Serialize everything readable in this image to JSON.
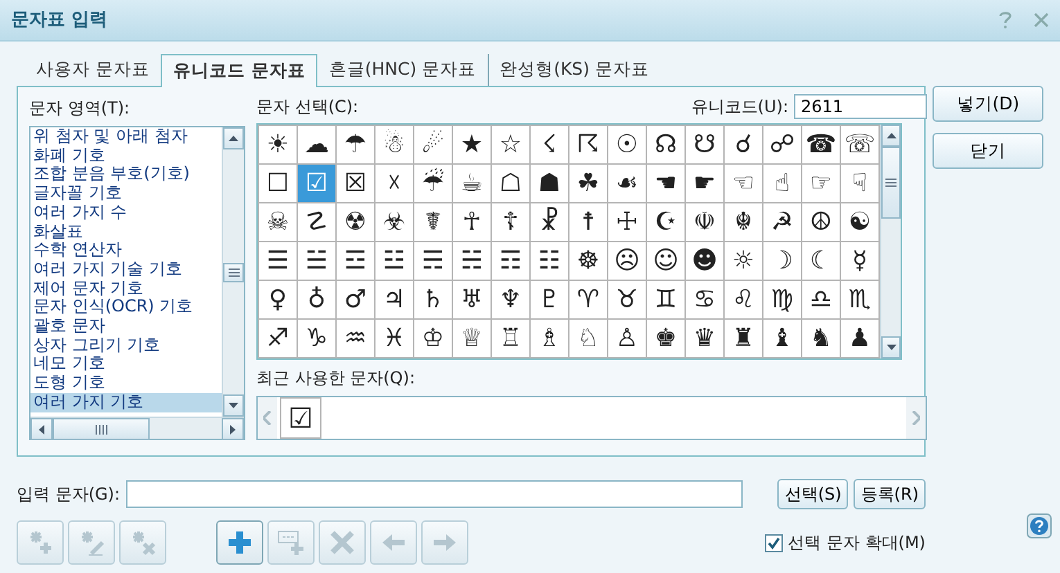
{
  "window": {
    "title": "문자표 입력"
  },
  "tabs": [
    {
      "label": "사용자 문자표",
      "selected": false
    },
    {
      "label": "유니코드 문자표",
      "selected": true
    },
    {
      "label": "흔글(HNC) 문자표",
      "selected": false
    },
    {
      "label": "완성형(KS) 문자표",
      "selected": false
    }
  ],
  "category": {
    "label": "문자 영역(T):",
    "items": [
      {
        "label": "위 첨자 및 아래 첨자",
        "selected": false
      },
      {
        "label": "화폐 기호",
        "selected": false
      },
      {
        "label": "조합 분음 부호(기호)",
        "selected": false
      },
      {
        "label": "글자꼴 기호",
        "selected": false
      },
      {
        "label": "여러 가지 수",
        "selected": false
      },
      {
        "label": "화살표",
        "selected": false
      },
      {
        "label": "수학 연산자",
        "selected": false
      },
      {
        "label": "여러 가지 기술 기호",
        "selected": false
      },
      {
        "label": "제어 문자 기호",
        "selected": false
      },
      {
        "label": "문자 인식(OCR) 기호",
        "selected": false
      },
      {
        "label": "괄호 문자",
        "selected": false
      },
      {
        "label": "상자 그리기 기호",
        "selected": false
      },
      {
        "label": "네모 기호",
        "selected": false
      },
      {
        "label": "도형 기호",
        "selected": false
      },
      {
        "label": "여러 가지 기호",
        "selected": true
      }
    ]
  },
  "chars": {
    "label": "문자 선택(C):",
    "code_label": "유니코드(U):",
    "code_value": "2611",
    "rows": [
      {
        "cells": [
          {
            "char": "☀",
            "selected": false
          },
          {
            "char": "☁",
            "selected": false
          },
          {
            "char": "☂",
            "selected": false
          },
          {
            "char": "☃",
            "selected": false
          },
          {
            "char": "☄",
            "selected": false
          },
          {
            "char": "★",
            "selected": false
          },
          {
            "char": "☆",
            "selected": false
          },
          {
            "char": "☇",
            "selected": false
          },
          {
            "char": "☈",
            "selected": false
          },
          {
            "char": "☉",
            "selected": false
          },
          {
            "char": "☊",
            "selected": false
          },
          {
            "char": "☋",
            "selected": false
          },
          {
            "char": "☌",
            "selected": false
          },
          {
            "char": "☍",
            "selected": false
          },
          {
            "char": "☎",
            "selected": false
          },
          {
            "char": "☏",
            "selected": false
          }
        ]
      },
      {
        "cells": [
          {
            "char": "☐",
            "selected": false
          },
          {
            "char": "☑",
            "selected": true
          },
          {
            "char": "☒",
            "selected": false
          },
          {
            "char": "☓",
            "selected": false
          },
          {
            "char": "☔",
            "selected": false
          },
          {
            "char": "☕",
            "selected": false
          },
          {
            "char": "☖",
            "selected": false
          },
          {
            "char": "☗",
            "selected": false
          },
          {
            "char": "☘",
            "selected": false
          },
          {
            "char": "☙",
            "selected": false
          },
          {
            "char": "☚",
            "selected": false
          },
          {
            "char": "☛",
            "selected": false
          },
          {
            "char": "☜",
            "selected": false
          },
          {
            "char": "☝",
            "selected": false
          },
          {
            "char": "☞",
            "selected": false
          },
          {
            "char": "☟",
            "selected": false
          }
        ]
      },
      {
        "cells": [
          {
            "char": "☠",
            "selected": false
          },
          {
            "char": "☡",
            "selected": false
          },
          {
            "char": "☢",
            "selected": false
          },
          {
            "char": "☣",
            "selected": false
          },
          {
            "char": "☤",
            "selected": false
          },
          {
            "char": "☥",
            "selected": false
          },
          {
            "char": "☦",
            "selected": false
          },
          {
            "char": "☧",
            "selected": false
          },
          {
            "char": "☨",
            "selected": false
          },
          {
            "char": "☩",
            "selected": false
          },
          {
            "char": "☪",
            "selected": false
          },
          {
            "char": "☫",
            "selected": false
          },
          {
            "char": "☬",
            "selected": false
          },
          {
            "char": "☭",
            "selected": false
          },
          {
            "char": "☮",
            "selected": false
          },
          {
            "char": "☯",
            "selected": false
          }
        ]
      },
      {
        "cells": [
          {
            "char": "☰",
            "selected": false
          },
          {
            "char": "☱",
            "selected": false
          },
          {
            "char": "☲",
            "selected": false
          },
          {
            "char": "☳",
            "selected": false
          },
          {
            "char": "☴",
            "selected": false
          },
          {
            "char": "☵",
            "selected": false
          },
          {
            "char": "☶",
            "selected": false
          },
          {
            "char": "☷",
            "selected": false
          },
          {
            "char": "☸",
            "selected": false
          },
          {
            "char": "☹",
            "selected": false
          },
          {
            "char": "☺",
            "selected": false
          },
          {
            "char": "☻",
            "selected": false
          },
          {
            "char": "☼",
            "selected": false
          },
          {
            "char": "☽",
            "selected": false
          },
          {
            "char": "☾",
            "selected": false
          },
          {
            "char": "☿",
            "selected": false
          }
        ]
      },
      {
        "cells": [
          {
            "char": "♀",
            "selected": false
          },
          {
            "char": "♁",
            "selected": false
          },
          {
            "char": "♂",
            "selected": false
          },
          {
            "char": "♃",
            "selected": false
          },
          {
            "char": "♄",
            "selected": false
          },
          {
            "char": "♅",
            "selected": false
          },
          {
            "char": "♆",
            "selected": false
          },
          {
            "char": "♇",
            "selected": false
          },
          {
            "char": "♈",
            "selected": false
          },
          {
            "char": "♉",
            "selected": false
          },
          {
            "char": "♊",
            "selected": false
          },
          {
            "char": "♋",
            "selected": false
          },
          {
            "char": "♌",
            "selected": false
          },
          {
            "char": "♍",
            "selected": false
          },
          {
            "char": "♎",
            "selected": false
          },
          {
            "char": "♏",
            "selected": false
          }
        ]
      },
      {
        "cells": [
          {
            "char": "♐",
            "selected": false
          },
          {
            "char": "♑",
            "selected": false
          },
          {
            "char": "♒",
            "selected": false
          },
          {
            "char": "♓",
            "selected": false
          },
          {
            "char": "♔",
            "selected": false
          },
          {
            "char": "♕",
            "selected": false
          },
          {
            "char": "♖",
            "selected": false
          },
          {
            "char": "♗",
            "selected": false
          },
          {
            "char": "♘",
            "selected": false
          },
          {
            "char": "♙",
            "selected": false
          },
          {
            "char": "♚",
            "selected": false
          },
          {
            "char": "♛",
            "selected": false
          },
          {
            "char": "♜",
            "selected": false
          },
          {
            "char": "♝",
            "selected": false
          },
          {
            "char": "♞",
            "selected": false
          },
          {
            "char": "♟",
            "selected": false
          }
        ]
      }
    ]
  },
  "recent": {
    "label": "최근 사용한 문자(Q):",
    "items": [
      "☑"
    ]
  },
  "side_buttons": [
    "넣기(D)",
    "닫기"
  ],
  "input": {
    "label": "입력 문자(G):",
    "buttons": [
      "선택(S)",
      "등록(R)"
    ]
  },
  "toolbar": [
    {
      "kind": "add-star",
      "disabled": true
    },
    {
      "kind": "edit-star",
      "disabled": true
    },
    {
      "kind": "remove-star",
      "disabled": true
    },
    {
      "kind": "plus",
      "disabled": false
    },
    {
      "kind": "add-row",
      "disabled": true
    },
    {
      "kind": "delete",
      "disabled": true
    },
    {
      "kind": "left",
      "disabled": true
    },
    {
      "kind": "right",
      "disabled": true
    }
  ],
  "enlarge": {
    "label": "선택 문자 확대(M)",
    "checked": true
  }
}
